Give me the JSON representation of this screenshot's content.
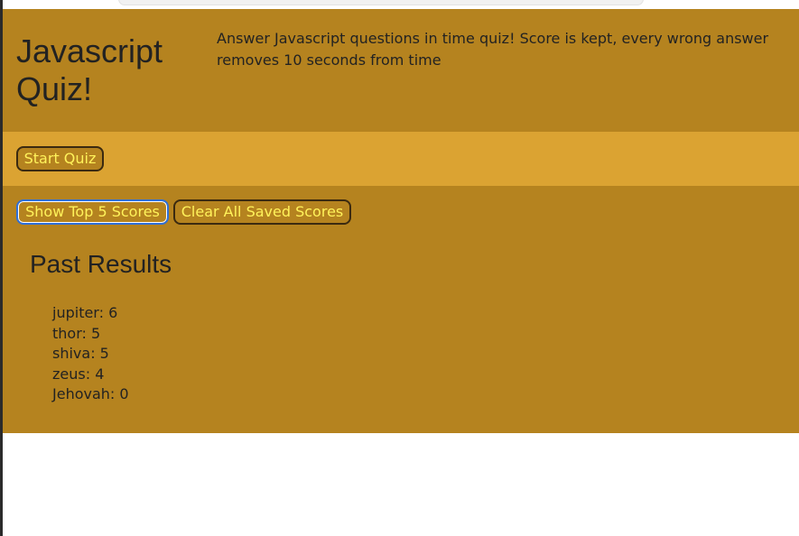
{
  "header": {
    "title": "Javascript Quiz!",
    "description": "Answer Javascript questions in time quiz! Score is kept, every wrong answer removes 10 seconds from time"
  },
  "controls": {
    "start_label": "Start Quiz",
    "show_scores_label": "Show Top 5 Scores",
    "clear_scores_label": "Clear All Saved Scores"
  },
  "results": {
    "title": "Past Results",
    "entries": [
      "jupiter: 6",
      "thor: 5",
      "shiva: 5",
      "zeus: 4",
      "Jehovah: 0"
    ]
  },
  "colors": {
    "header_bg": "#b5831f",
    "start_bar_bg": "#dba332",
    "button_text": "#fff25a",
    "text": "#222222",
    "focus_ring": "#2f6fd6"
  }
}
